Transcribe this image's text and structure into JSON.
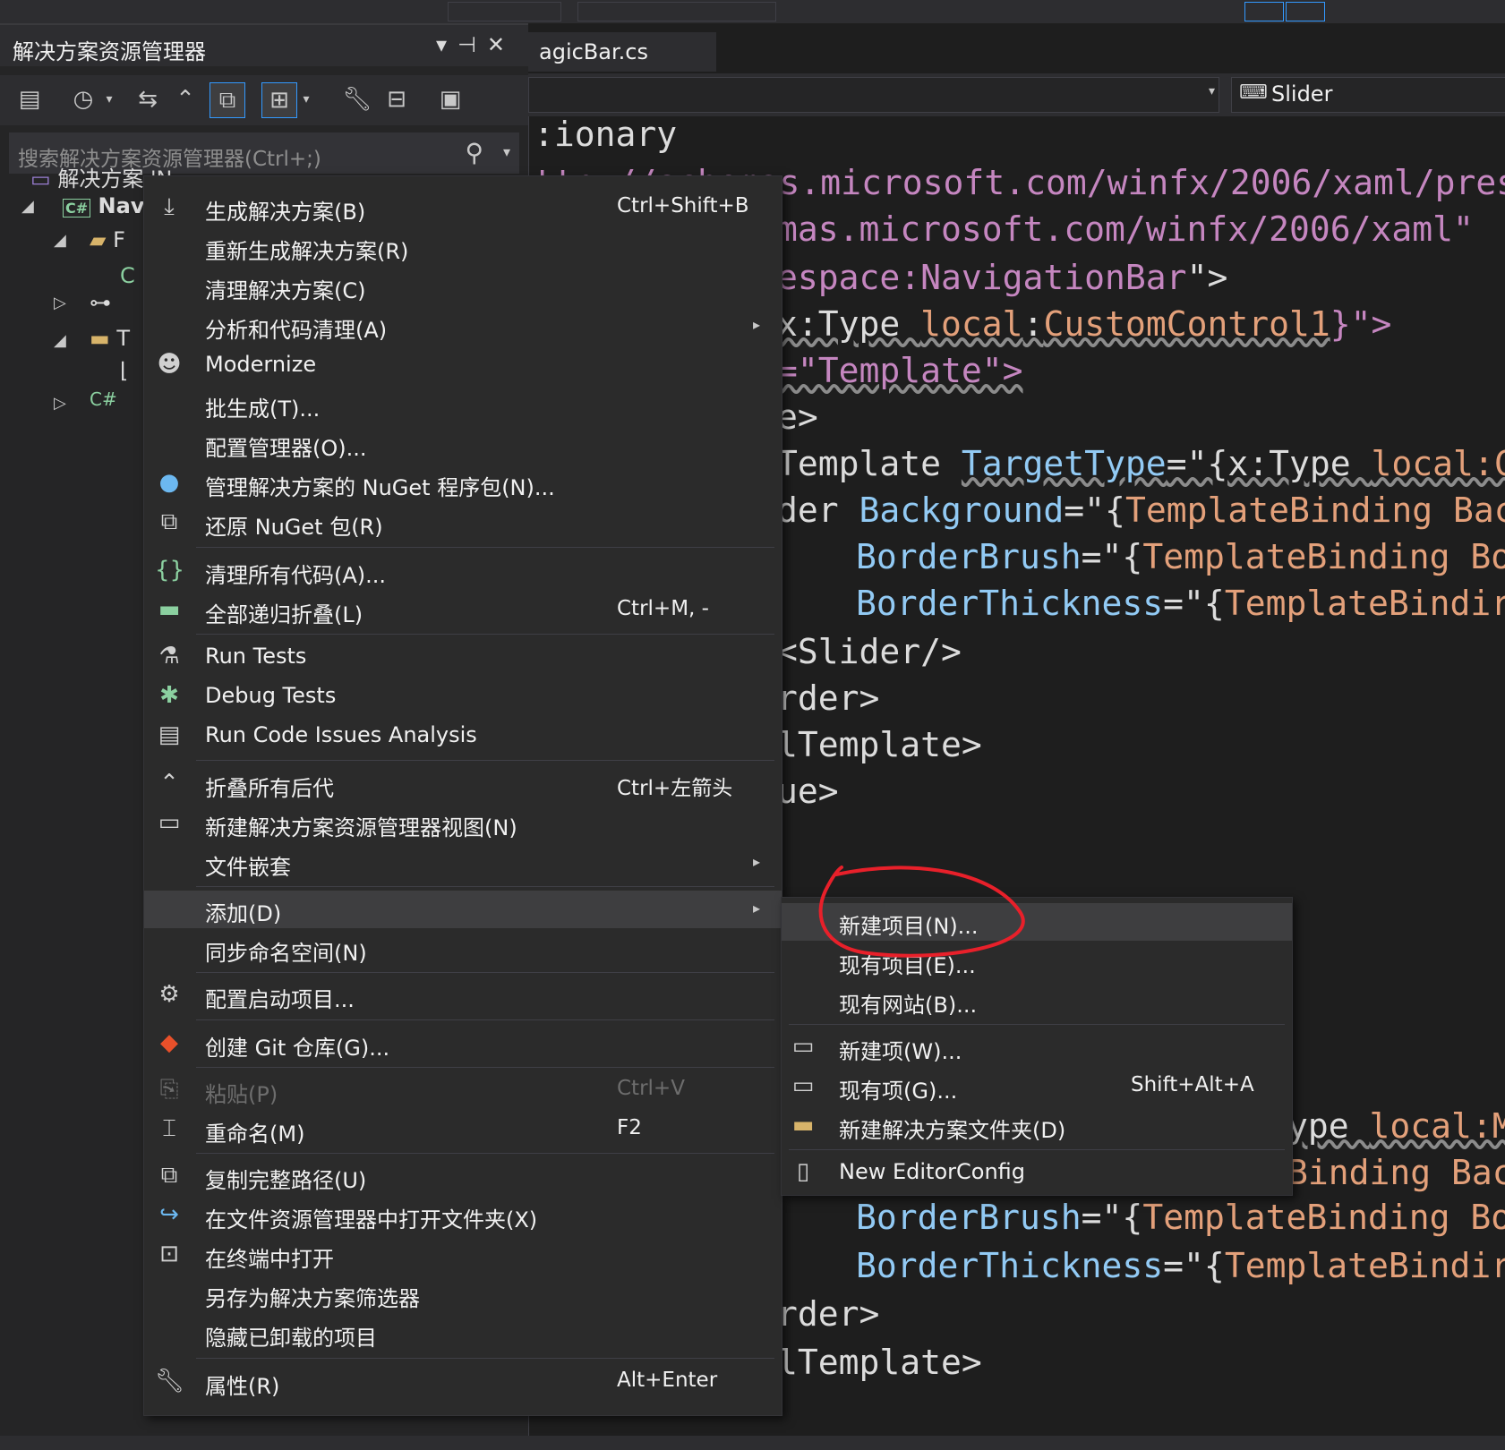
{
  "solution_explorer": {
    "title": "解决方案资源管理器",
    "search_placeholder": "搜索解决方案资源管理器(Ctrl+;)",
    "tree": {
      "solution": "解决方案 'N...",
      "project": "Nav",
      "item_f": "F",
      "item_c": "C",
      "item_t": "T",
      "item_cs": "C#"
    }
  },
  "editor": {
    "tab_title": "agicBar.cs",
    "nav_member": "Slider",
    "lines": {
      "l1": ":ionary",
      "l2": "ttp://schemas.microsoft.com/winfx/2006/xaml/pres",
      "l3": "mas.microsoft.com/winfx/2006/xaml\"",
      "l4a": "espace:NavigationBar",
      "l4b": "\">",
      "l5a": "x:Type ",
      "l5b": "local",
      "l5c": ":",
      "l5d": "CustomControl1",
      "l5e": "}\">",
      "l6": "=\"Template\">",
      "l7": "e>",
      "l8a": "Template ",
      "l8b": "TargetType",
      "l8c": "=\"{x:Type ",
      "l8d": "local:C",
      "l9a": "der ",
      "l9b": "Background",
      "l9c": "=\"{",
      "l9d": "TemplateBinding Bac",
      "l10a": "BorderBrush",
      "l10b": "=\"{",
      "l10c": "TemplateBinding Bo",
      "l11a": "BorderThickness",
      "l11b": "=\"{",
      "l11c": "TemplateBindir",
      "l12": "<Slider/>",
      "l13": "rder>",
      "l14": "lTemplate>",
      "l15": "ue>",
      "l16a": "ype ",
      "l16b": "local:M",
      "l17a": "Binding Bac",
      "l18a": "BorderBrush",
      "l18b": "=\"{",
      "l18c": "TemplateBinding Bo",
      "l19a": "BorderThickness",
      "l19b": "=\"{",
      "l19c": "TemplateBindir",
      "l20": "rder>",
      "l21": "lTemplate>"
    }
  },
  "context_menu": {
    "items": [
      {
        "label": "生成解决方案(B)",
        "shortcut": "Ctrl+Shift+B",
        "icon": "build-icon"
      },
      {
        "label": "重新生成解决方案(R)",
        "shortcut": "",
        "icon": ""
      },
      {
        "label": "清理解决方案(C)",
        "shortcut": "",
        "icon": ""
      },
      {
        "label": "分析和代码清理(A)",
        "shortcut": "",
        "icon": ""
      },
      {
        "label": "Modernize",
        "shortcut": "",
        "icon": "copilot-icon"
      },
      {
        "label": "批生成(T)...",
        "shortcut": "",
        "icon": ""
      },
      {
        "label": "配置管理器(O)...",
        "shortcut": "",
        "icon": ""
      },
      {
        "label": "管理解决方案的 NuGet 程序包(N)...",
        "shortcut": "",
        "icon": "nuget-icon"
      },
      {
        "label": "还原 NuGet 包(R)",
        "shortcut": "",
        "icon": "restore-icon"
      },
      {
        "label": "清理所有代码(A)...",
        "shortcut": "",
        "icon": "code-cleanup-icon"
      },
      {
        "label": "全部递归折叠(L)",
        "shortcut": "Ctrl+M, -",
        "icon": "collapse-icon"
      },
      {
        "label": "Run Tests",
        "shortcut": "",
        "icon": "run-tests-icon"
      },
      {
        "label": "Debug Tests",
        "shortcut": "",
        "icon": "debug-tests-icon"
      },
      {
        "label": "Run Code Issues Analysis",
        "shortcut": "",
        "icon": "analysis-icon"
      },
      {
        "label": "折叠所有后代",
        "shortcut": "Ctrl+左箭头",
        "icon": "chevron-up-icon"
      },
      {
        "label": "新建解决方案资源管理器视图(N)",
        "shortcut": "",
        "icon": "new-view-icon"
      },
      {
        "label": "文件嵌套",
        "shortcut": "",
        "icon": ""
      },
      {
        "label": "添加(D)",
        "shortcut": "",
        "icon": ""
      },
      {
        "label": "同步命名空间(N)",
        "shortcut": "",
        "icon": ""
      },
      {
        "label": "配置启动项目...",
        "shortcut": "",
        "icon": "gear-icon"
      },
      {
        "label": "创建 Git 仓库(G)...",
        "shortcut": "",
        "icon": "git-icon"
      },
      {
        "label": "粘贴(P)",
        "shortcut": "Ctrl+V",
        "icon": "paste-icon"
      },
      {
        "label": "重命名(M)",
        "shortcut": "F2",
        "icon": "rename-icon"
      },
      {
        "label": "复制完整路径(U)",
        "shortcut": "",
        "icon": "copy-icon"
      },
      {
        "label": "在文件资源管理器中打开文件夹(X)",
        "shortcut": "",
        "icon": "open-folder-icon"
      },
      {
        "label": "在终端中打开",
        "shortcut": "",
        "icon": "terminal-icon"
      },
      {
        "label": "另存为解决方案筛选器",
        "shortcut": "",
        "icon": ""
      },
      {
        "label": "隐藏已卸载的项目",
        "shortcut": "",
        "icon": ""
      },
      {
        "label": "属性(R)",
        "shortcut": "Alt+Enter",
        "icon": "wrench-icon"
      }
    ]
  },
  "add_submenu": {
    "items": [
      {
        "label": "新建项目(N)...",
        "shortcut": ""
      },
      {
        "label": "现有项目(E)...",
        "shortcut": ""
      },
      {
        "label": "现有网站(B)...",
        "shortcut": ""
      },
      {
        "label": "新建项(W)...",
        "shortcut": ""
      },
      {
        "label": "现有项(G)...",
        "shortcut": "Shift+Alt+A"
      },
      {
        "label": "新建解决方案文件夹(D)",
        "shortcut": ""
      },
      {
        "label": "New EditorConfig",
        "shortcut": ""
      }
    ]
  },
  "colors": {
    "menu_bg": "#2b2b2b",
    "highlight": "#3e3e40",
    "annotation_red": "#e8202a",
    "xml_attr": "#92caf4",
    "xml_value": "#e3a07a"
  }
}
